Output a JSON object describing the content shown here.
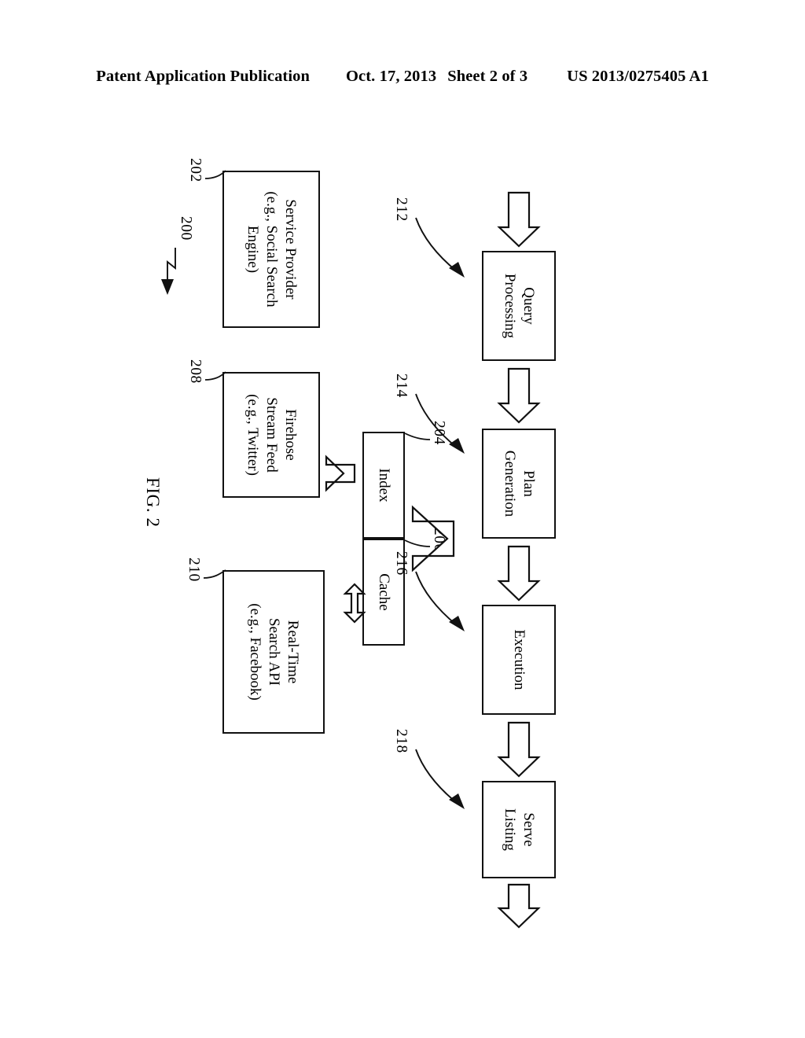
{
  "header": {
    "publication": "Patent Application Publication",
    "date": "Oct. 17, 2013",
    "sheet": "Sheet 2 of 3",
    "doc_number": "US 2013/0275405 A1"
  },
  "figure": {
    "label": "FIG. 2",
    "system_ref": "200"
  },
  "nodes": [
    {
      "id": "service-provider",
      "ref": "202",
      "lines": [
        "Service Provider",
        "(e.g., Social Search",
        "Engine)"
      ]
    },
    {
      "id": "firehose-stream-feed",
      "ref": "208",
      "lines": [
        "Firehose",
        "Stream Feed",
        "(e.g., Twitter)"
      ]
    },
    {
      "id": "real-time-search-api",
      "ref": "210",
      "lines": [
        "Real-Time",
        "Search API",
        "(e.g., Facebook)"
      ]
    },
    {
      "id": "index",
      "ref": "204",
      "lines": [
        "Index"
      ]
    },
    {
      "id": "cache",
      "ref": "206",
      "lines": [
        "Cache"
      ]
    },
    {
      "id": "query-processing",
      "ref": "212",
      "lines": [
        "Query",
        "Processing"
      ]
    },
    {
      "id": "plan-generation",
      "ref": "214",
      "lines": [
        "Plan",
        "Generation"
      ]
    },
    {
      "id": "execution",
      "ref": "216",
      "lines": [
        "Execution"
      ]
    },
    {
      "id": "serve-listing",
      "ref": "218",
      "lines": [
        "Serve",
        "Listing"
      ]
    }
  ],
  "callouts": [
    {
      "id": "callout-212",
      "ref": "212",
      "points_to": "query-processing"
    },
    {
      "id": "callout-214",
      "ref": "214",
      "points_to": "plan-generation"
    },
    {
      "id": "callout-216",
      "ref": "216",
      "points_to": "execution"
    },
    {
      "id": "callout-218",
      "ref": "218",
      "points_to": "serve-listing"
    }
  ],
  "colors": {
    "ink": "#111111",
    "paper": "#ffffff"
  }
}
